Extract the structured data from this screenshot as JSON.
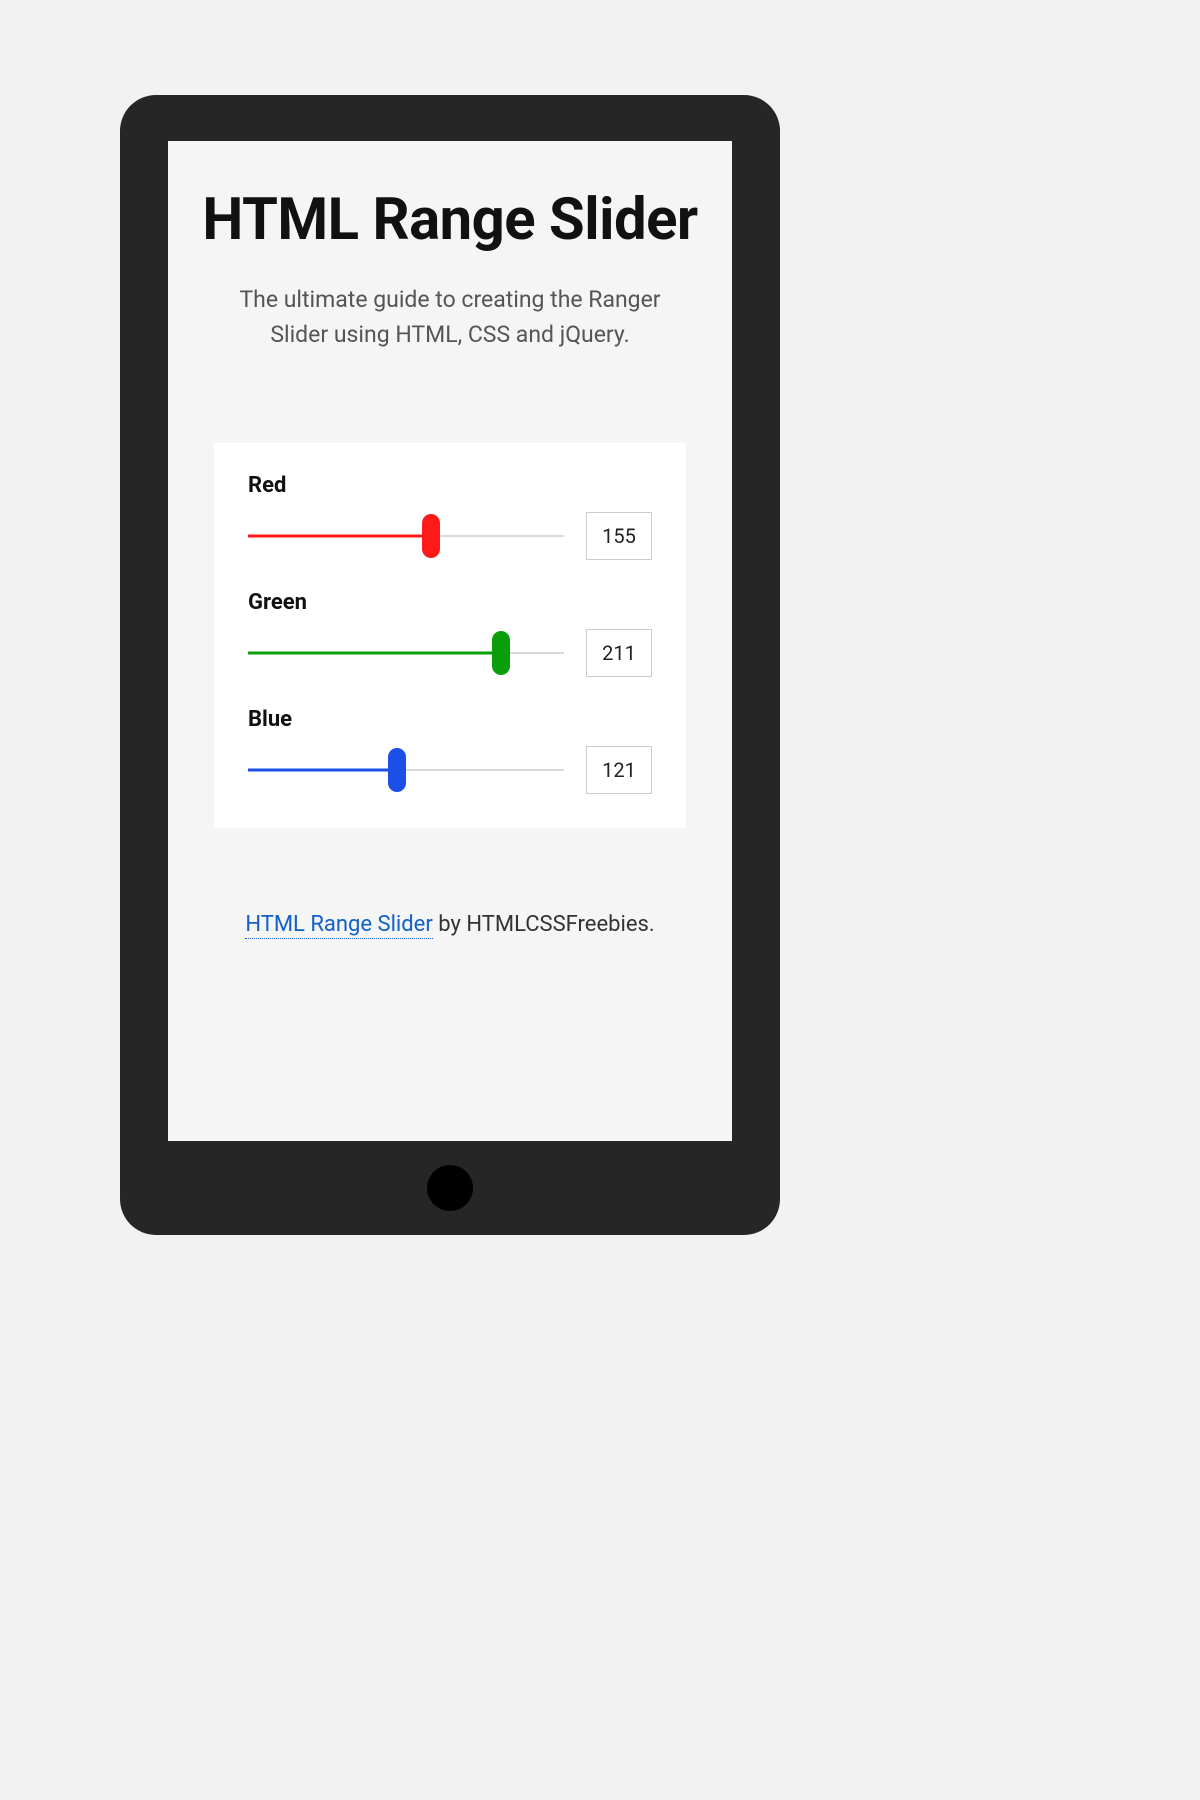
{
  "header": {
    "title": "HTML Range Slider",
    "subtitle": "The ultimate guide to creating the Ranger Slider using HTML, CSS and jQuery."
  },
  "sliders": {
    "min": 0,
    "max": 255,
    "items": [
      {
        "label": "Red",
        "value": 155,
        "percent": 58,
        "color": "#ff1a1a"
      },
      {
        "label": "Green",
        "value": 211,
        "percent": 80,
        "color": "#0a9e0a"
      },
      {
        "label": "Blue",
        "value": 121,
        "percent": 47,
        "color": "#1c4fe8"
      }
    ]
  },
  "credit": {
    "link_text": "HTML Range Slider",
    "suffix": " by HTMLCSSFreebies."
  }
}
